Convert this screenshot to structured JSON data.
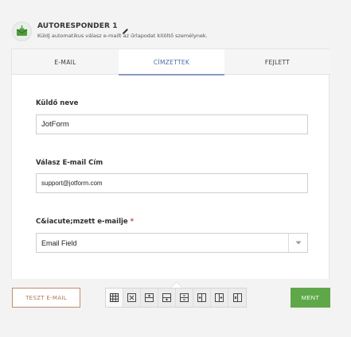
{
  "header": {
    "title": "AUTORESPONDER 1",
    "subtitle": "Küldj automatikus válasz e-mailt az űrlapodat kitöltő személynek."
  },
  "tabs": [
    {
      "label": "E-MAIL",
      "active": false
    },
    {
      "label": "CÍMZETTEK",
      "active": true
    },
    {
      "label": "FEJLETT",
      "active": false
    }
  ],
  "form": {
    "sender_name": {
      "label": "Küldő neve",
      "value": "JotForm"
    },
    "reply_email": {
      "label": "Válasz E-mail Cím",
      "value": "support@jotform.com"
    },
    "recipient_email": {
      "label": "C&iacute;mzett e-mailje",
      "required_mark": "*",
      "value": "Email Field"
    }
  },
  "footer": {
    "test_button": "TESZT E-MAIL",
    "save_button": "MENT",
    "toolbar_icons": [
      "table-icon",
      "table-remove-icon",
      "insert-row-above-icon",
      "insert-row-below-icon",
      "delete-row-icon",
      "insert-column-left-icon",
      "insert-column-right-icon",
      "delete-column-icon"
    ]
  },
  "colors": {
    "accent_tab": "#4d6aa8",
    "save_green": "#5fa84a",
    "test_border": "#c28b6e",
    "required_red": "#d23b3b"
  }
}
